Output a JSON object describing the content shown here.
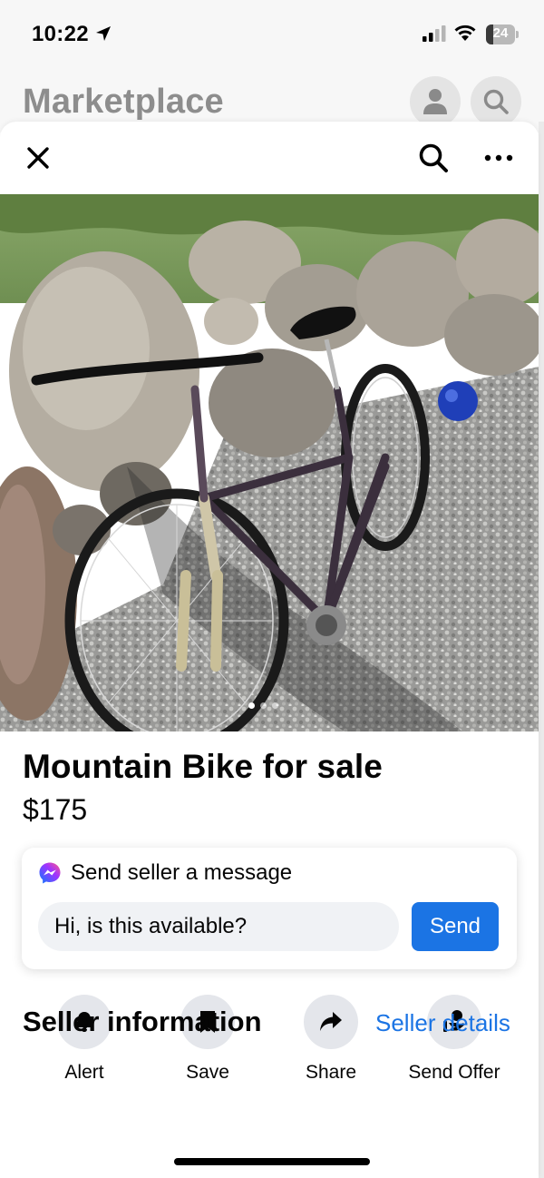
{
  "status_bar": {
    "time": "10:22",
    "battery": "24",
    "battery_level": 0.24
  },
  "header": {
    "title": "Marketplace",
    "profile_icon": "profile-icon",
    "search_icon": "search-icon"
  },
  "sheet": {
    "close_icon": "close-icon",
    "search_icon": "search-icon",
    "more_icon": "more-icon"
  },
  "listing": {
    "photo_description": "photo-bike-on-gravel",
    "photo_count": 3,
    "active_photo": 1,
    "title": "Mountain Bike for sale",
    "price": "$175"
  },
  "message": {
    "header": "Send seller a message",
    "input_value": "Hi, is this available?",
    "send_label": "Send"
  },
  "actions": [
    {
      "label": "Alert",
      "icon": "bell-icon"
    },
    {
      "label": "Save",
      "icon": "bookmark-icon"
    },
    {
      "label": "Share",
      "icon": "share-arrow-icon"
    },
    {
      "label": "Send Offer",
      "icon": "offer-hand-icon"
    }
  ],
  "seller": {
    "title": "Seller information",
    "link": "Seller details"
  },
  "colors": {
    "accent": "#1b74e4",
    "chip_bg": "#e4e6eb"
  }
}
